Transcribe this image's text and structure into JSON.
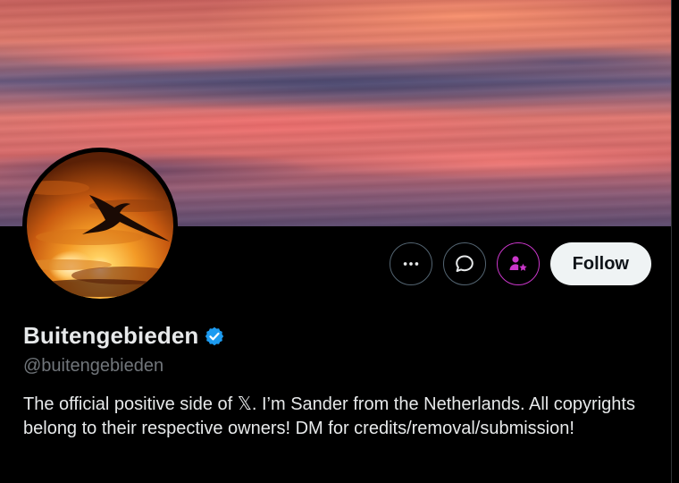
{
  "profile": {
    "display_name": "Buitengebieden",
    "handle": "@buitengebieden",
    "bio": "The official positive side of 𝕏. I’m Sander from the Netherlands. All copyrights belong to their respective owners! DM for credits/removal/submission!",
    "verified": true
  },
  "actions": {
    "more_icon": "more-horizontal-icon",
    "message_icon": "message-bubble-icon",
    "subscribe_icon": "person-star-icon",
    "follow_label": "Follow"
  },
  "colors": {
    "background": "#000000",
    "verified_badge": "#1d9bf0",
    "subscribe_accent": "#c936c9",
    "follow_button_bg": "#eff3f4",
    "handle_gray": "#71767b"
  }
}
